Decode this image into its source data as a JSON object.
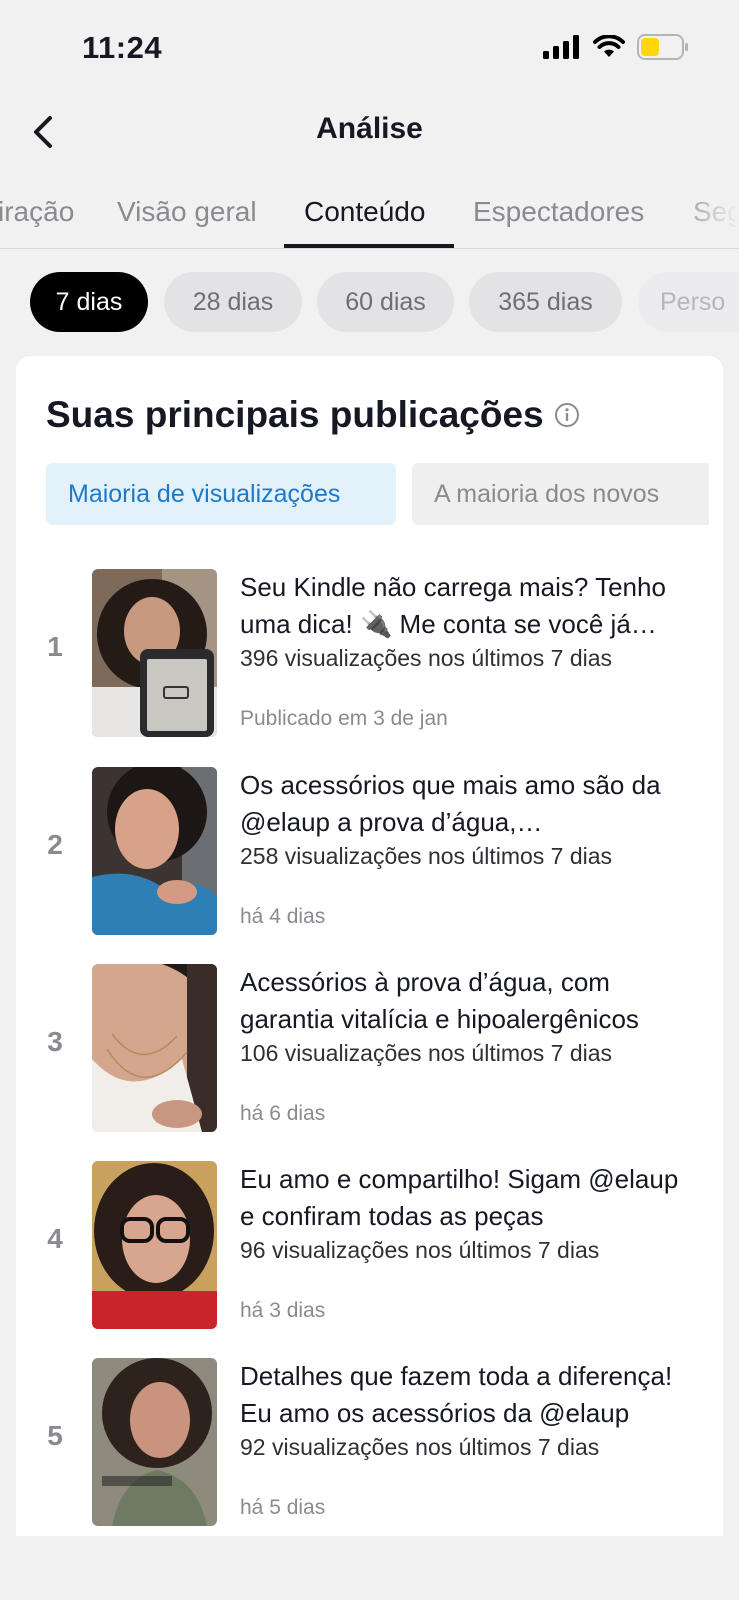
{
  "status": {
    "time": "11:24"
  },
  "nav": {
    "title": "Análise"
  },
  "tabs": [
    {
      "label": "iração"
    },
    {
      "label": "Visão geral"
    },
    {
      "label": "Conteúdo"
    },
    {
      "label": "Espectadores"
    },
    {
      "label": "Seg"
    }
  ],
  "active_tab": "Conteúdo",
  "periods": [
    {
      "label": "7 dias"
    },
    {
      "label": "28 dias"
    },
    {
      "label": "60 dias"
    },
    {
      "label": "365 dias"
    },
    {
      "label": "Perso"
    }
  ],
  "selected_period": "7 dias",
  "section": {
    "title": "Suas principais publicações",
    "sort_options": [
      {
        "label": "Maioria de visualizações"
      },
      {
        "label": "A maioria dos novos"
      }
    ],
    "selected_sort": "Maioria de visualizações"
  },
  "posts": [
    {
      "rank": "1",
      "title": "Seu Kindle não carrega mais? Tenho uma dica! 🔌 Me conta se você já passou por isso",
      "views": "396 visualizações nos últimos 7 dias",
      "date": "Publicado em 3 de jan"
    },
    {
      "rank": "2",
      "title": "Os acessórios que mais amo são da @elaup a prova d’água, hipoalergênicos",
      "views": "258 visualizações nos últimos 7 dias",
      "date": "há 4 dias"
    },
    {
      "rank": "3",
      "title": "Acessórios à prova d’água, com garantia vitalícia e hipoalergênicos",
      "views": "106 visualizações nos últimos 7 dias",
      "date": "há 6 dias"
    },
    {
      "rank": "4",
      "title": "Eu amo e compartilho! Sigam @elaup e confiram todas as peças",
      "views": "96 visualizações nos últimos 7 dias",
      "date": "há 3 dias"
    },
    {
      "rank": "5",
      "title": "Detalhes que fazem toda a diferença! Eu amo os acessórios da @elaup",
      "views": "92 visualizações nos últimos 7 dias",
      "date": "há 5 dias"
    }
  ],
  "colors": {
    "active_pill": "#000000",
    "sort_active_bg": "#e3f1fb",
    "sort_active_text": "#1d7ac8",
    "battery": "#ffd60a"
  }
}
